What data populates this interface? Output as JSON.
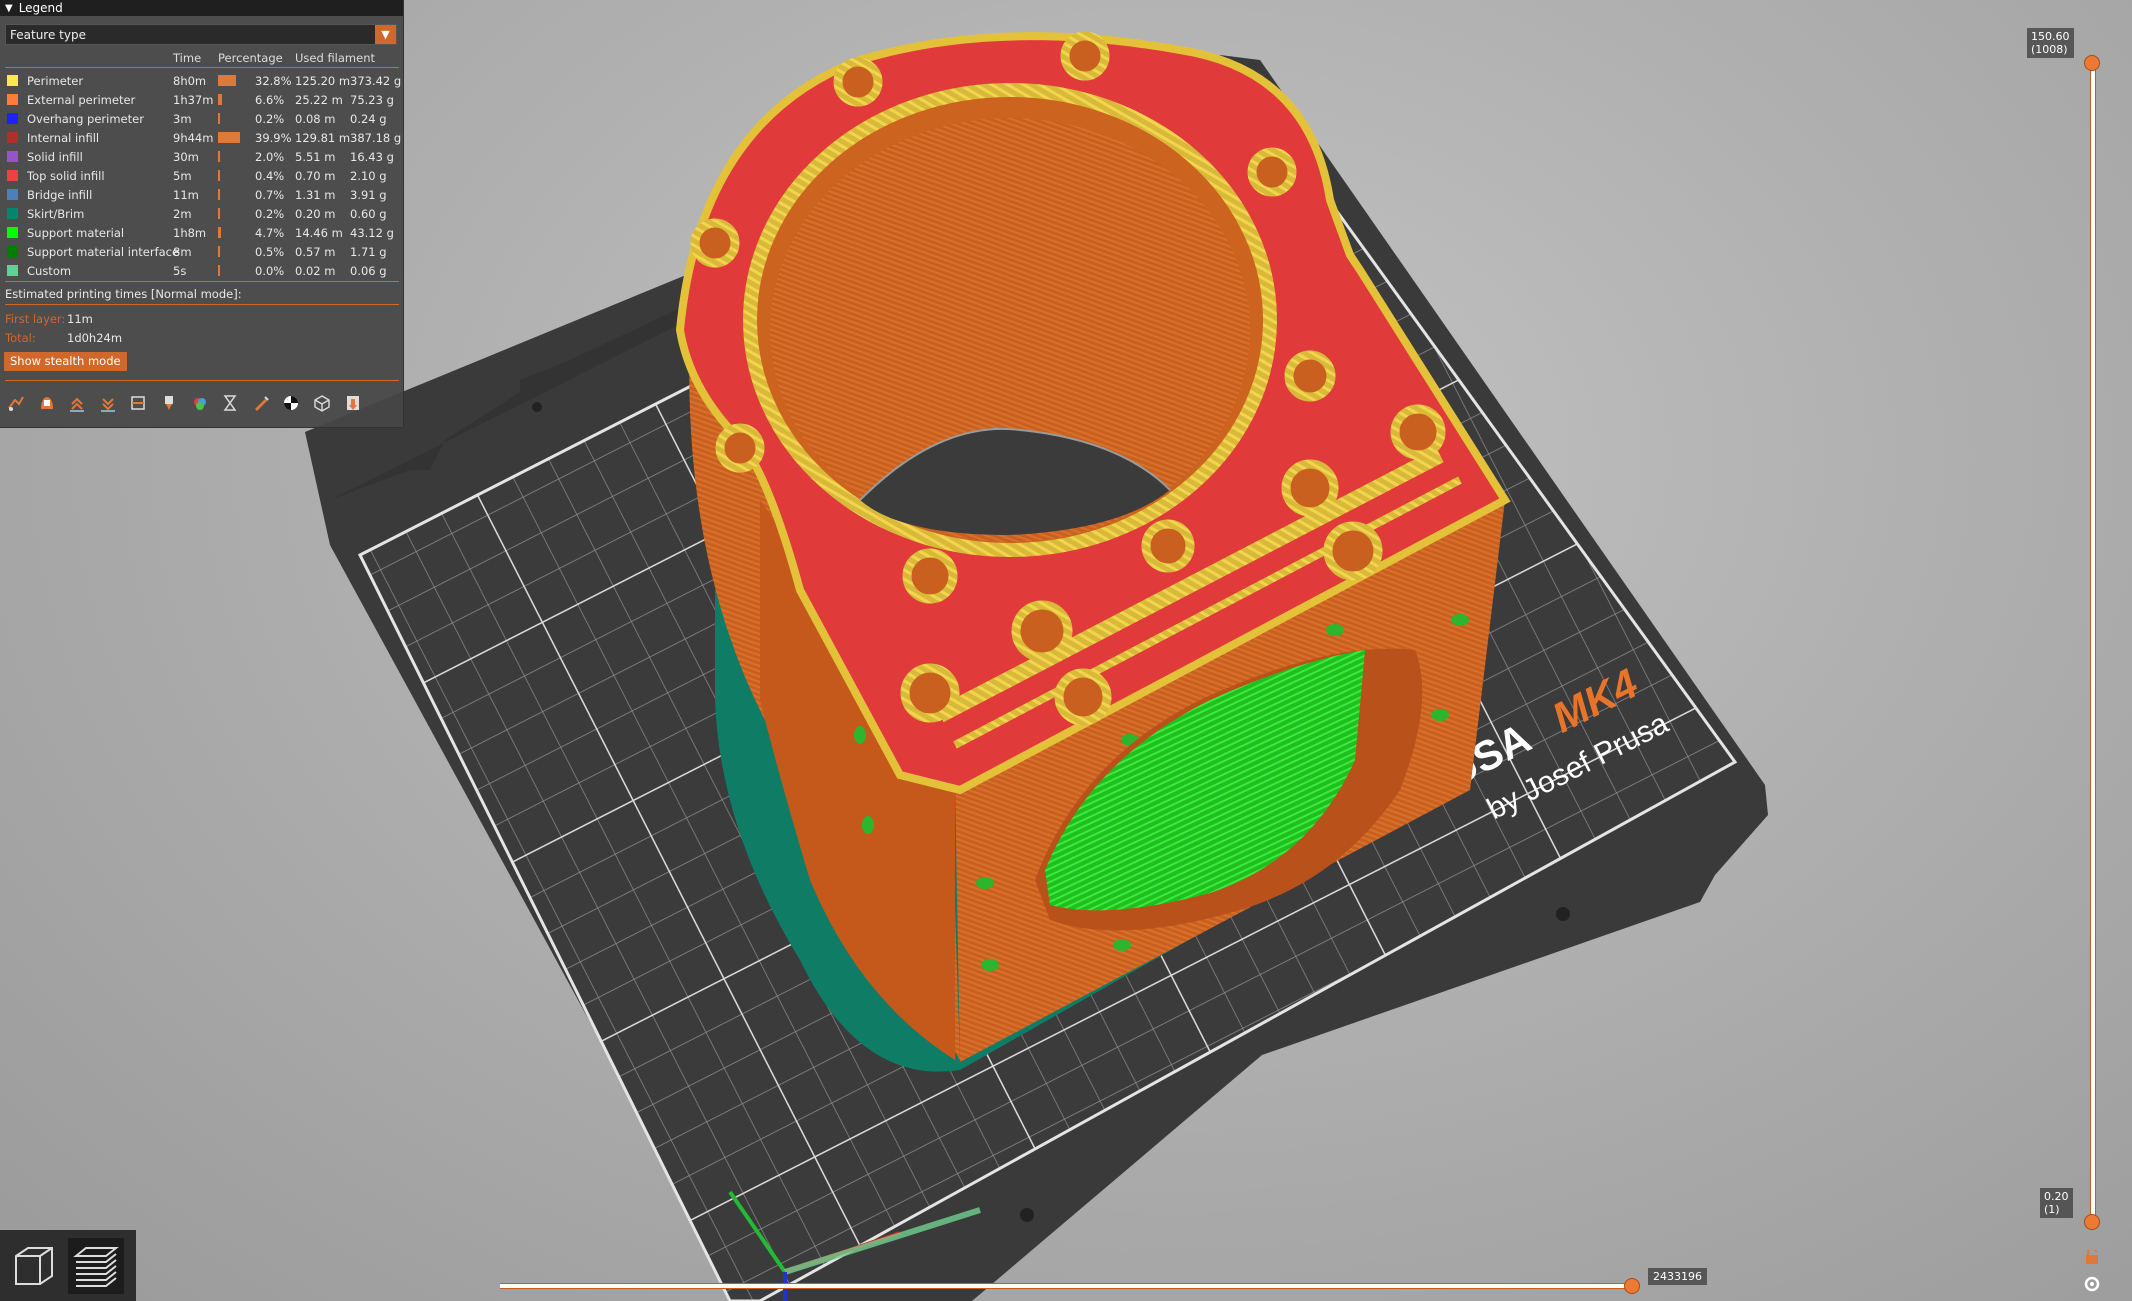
{
  "legend": {
    "title": "Legend",
    "view_type": "Feature type",
    "columns": {
      "time": "Time",
      "percentage": "Percentage",
      "used_filament": "Used filament"
    },
    "rows": [
      {
        "name": "Perimeter",
        "time": "8h0m",
        "percentage": "32.8%",
        "percent_value": 32.8,
        "length": "125.20 m",
        "weight": "373.42 g",
        "color": "#ffe64d"
      },
      {
        "name": "External perimeter",
        "time": "1h37m",
        "percentage": "6.6%",
        "percent_value": 6.6,
        "length": "25.22 m",
        "weight": "75.23 g",
        "color": "#ff7d38"
      },
      {
        "name": "Overhang perimeter",
        "time": "3m",
        "percentage": "0.2%",
        "percent_value": 0.2,
        "length": "0.08 m",
        "weight": "0.24 g",
        "color": "#1f1fff"
      },
      {
        "name": "Internal infill",
        "time": "9h44m",
        "percentage": "39.9%",
        "percent_value": 39.9,
        "length": "129.81 m",
        "weight": "387.18 g",
        "color": "#b03029"
      },
      {
        "name": "Solid infill",
        "time": "30m",
        "percentage": "2.0%",
        "percent_value": 2.0,
        "length": "5.51 m",
        "weight": "16.43 g",
        "color": "#9654cc"
      },
      {
        "name": "Top solid infill",
        "time": "5m",
        "percentage": "0.4%",
        "percent_value": 0.4,
        "length": "0.70 m",
        "weight": "2.10 g",
        "color": "#f04040"
      },
      {
        "name": "Bridge infill",
        "time": "11m",
        "percentage": "0.7%",
        "percent_value": 0.7,
        "length": "1.31 m",
        "weight": "3.91 g",
        "color": "#4d80ba"
      },
      {
        "name": "Skirt/Brim",
        "time": "2m",
        "percentage": "0.2%",
        "percent_value": 0.2,
        "length": "0.20 m",
        "weight": "0.60 g",
        "color": "#00876e"
      },
      {
        "name": "Support material",
        "time": "1h8m",
        "percentage": "4.7%",
        "percent_value": 4.7,
        "length": "14.46 m",
        "weight": "43.12 g",
        "color": "#00ff00"
      },
      {
        "name": "Support material interface",
        "time": "8m",
        "percentage": "0.5%",
        "percent_value": 0.5,
        "length": "0.57 m",
        "weight": "1.71 g",
        "color": "#008000"
      },
      {
        "name": "Custom",
        "time": "5s",
        "percentage": "0.0%",
        "percent_value": 0.0,
        "length": "0.02 m",
        "weight": "0.06 g",
        "color": "#5ed194"
      }
    ],
    "estimated_title": "Estimated printing times [Normal mode]:",
    "first_layer_label": "First layer:",
    "first_layer_value": "11m",
    "total_label": "Total:",
    "total_value": "1d0h24m",
    "stealth_button": "Show stealth mode",
    "tools": [
      "travel-icon",
      "wipe-icon",
      "retractions-icon",
      "deretractions-icon",
      "seams-icon",
      "tool-changes-icon",
      "color-changes-icon",
      "pause-prints-icon",
      "custom-gcodes-icon",
      "center-of-gravity-icon",
      "shells-icon",
      "tool-marker-icon"
    ]
  },
  "vertical_slider": {
    "top_value": "150.60",
    "top_layer": "(1008)",
    "bottom_value": "0.20",
    "bottom_layer": "(1)"
  },
  "horizontal_slider": {
    "value": "2433196"
  },
  "bed": {
    "brand": "USA MK4",
    "brand_prefix": "USA ",
    "brand_model": "MK4",
    "subtitle": "by Josef Prusa"
  },
  "colors": {
    "accent": "#d0682c",
    "panel": "#464646",
    "perimeter": "#ffe64d",
    "top_infill": "#e03a3a",
    "ext_perimeter": "#d86a26",
    "support": "#22dd22",
    "brim": "#0f7d66"
  },
  "view_toggles": [
    "3d-view-icon",
    "preview-layers-icon"
  ]
}
